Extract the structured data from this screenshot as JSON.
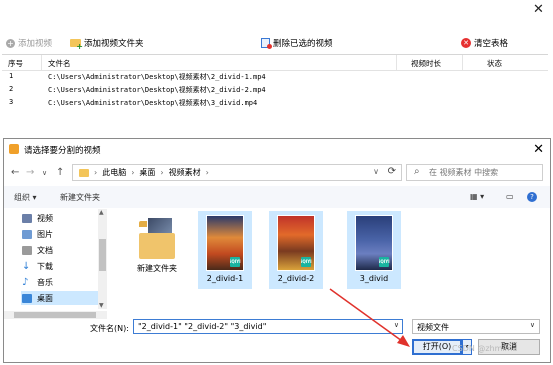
{
  "window": {
    "close_glyph": "✕"
  },
  "toolbar": {
    "add_video": "添加视频",
    "add_folder": "添加视频文件夹",
    "delete_selected": "删除已选的视频",
    "clear_table": "清空表格"
  },
  "table": {
    "headers": {
      "index": "序号",
      "file": "文件名",
      "duration": "视频时长",
      "status": "状态"
    },
    "rows": [
      {
        "index": "1",
        "file": "C:\\Users\\Administrator\\Desktop\\视频素材\\2_divid-1.mp4"
      },
      {
        "index": "2",
        "file": "C:\\Users\\Administrator\\Desktop\\视频素材\\2_divid-2.mp4"
      },
      {
        "index": "3",
        "file": "C:\\Users\\Administrator\\Desktop\\视频素材\\3_divid.mp4"
      }
    ]
  },
  "dialog": {
    "title": "请选择要分割的视频",
    "close_glyph": "✕",
    "nav": {
      "back": "←",
      "forward": "→",
      "recent": "∨",
      "up": "↑"
    },
    "breadcrumb": [
      "此电脑",
      "桌面",
      "视频素材"
    ],
    "search_placeholder": "在 视频素材 中搜索",
    "cmd": {
      "organize": "组织 ▾",
      "new_folder": "新建文件夹"
    },
    "sidebar": [
      {
        "label": "视频",
        "color": "#6b7fa8"
      },
      {
        "label": "图片",
        "color": "#6f9bd3"
      },
      {
        "label": "文档",
        "color": "#8a8a8a"
      },
      {
        "label": "下载",
        "color": "#2f7fd6"
      },
      {
        "label": "音乐",
        "color": "#2f7fd6"
      },
      {
        "label": "桌面",
        "color": "#3a86d8"
      }
    ],
    "files": [
      {
        "name": "新建文件夹",
        "kind": "folder"
      },
      {
        "name": "2_divid-1",
        "kind": "video",
        "badge": "iQIYI"
      },
      {
        "name": "2_divid-2",
        "kind": "video",
        "badge": "iQIYI"
      },
      {
        "name": "3_divid",
        "kind": "video",
        "badge": "iQIYI"
      }
    ],
    "filename_label": "文件名(N):",
    "filename_value": "\"2_divid-1\" \"2_divid-2\" \"3_divid\"",
    "filetype_value": "视频文件",
    "open_button": "打开(O)",
    "cancel_button": "取消"
  },
  "watermark": "CSDN @zhmima"
}
